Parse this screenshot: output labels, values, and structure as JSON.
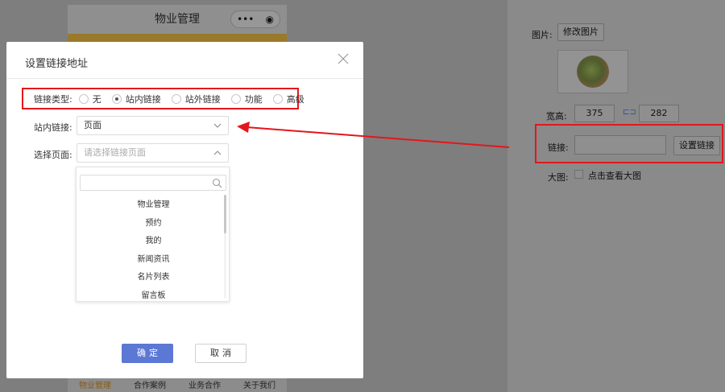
{
  "background": {
    "phone_title": "物业管理",
    "capsule_dots": "•••",
    "capsule_target": "◉",
    "tabbar": [
      "物业管理",
      "合作案例",
      "业务合作",
      "关于我们"
    ],
    "right_panel": {
      "image_label": "图片:",
      "modify_image_btn": "修改图片",
      "size_label": "宽高:",
      "width_value": "375",
      "height_value": "282",
      "link_label": "链接:",
      "set_link_btn": "设置链接",
      "large_image_label": "大图:",
      "large_image_checkbox": "点击查看大图"
    }
  },
  "modal": {
    "title": "设置链接地址",
    "link_type_label": "链接类型:",
    "link_types": [
      {
        "label": "无",
        "checked": false
      },
      {
        "label": "站内链接",
        "checked": true
      },
      {
        "label": "站外链接",
        "checked": false
      },
      {
        "label": "功能",
        "checked": false
      },
      {
        "label": "高级",
        "checked": false
      }
    ],
    "internal_link_label": "站内链接:",
    "internal_link_value": "页面",
    "select_page_label": "选择页面:",
    "select_page_placeholder": "请选择链接页面",
    "page_options": [
      "物业管理",
      "预约",
      "我的",
      "新闻资讯",
      "名片列表",
      "留言板"
    ],
    "ok_label": "确定",
    "cancel_label": "取消"
  },
  "colors": {
    "primary": "#5a78d4",
    "highlight_red": "#e4161b"
  }
}
